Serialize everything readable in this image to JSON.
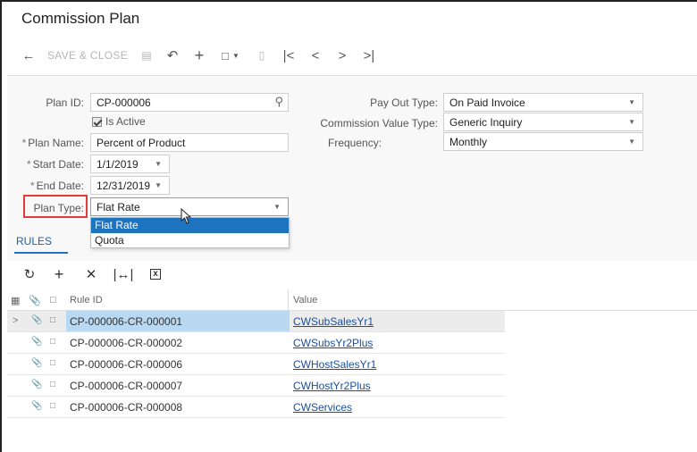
{
  "page": {
    "title": "Commission Plan"
  },
  "toolbar": {
    "save_close": "SAVE & CLOSE",
    "icons": [
      "back-arrow-icon",
      "save-icon",
      "undo-icon",
      "add-icon",
      "copy-icon",
      "delete-icon",
      "first-icon",
      "prev-icon",
      "next-icon",
      "last-icon"
    ]
  },
  "form": {
    "plan_id_label": "Plan ID:",
    "plan_id": "CP-000006",
    "is_active_label": "Is Active",
    "plan_name_label": "Plan Name:",
    "plan_name": "Percent of Product",
    "start_date_label": "Start Date:",
    "start_date": "1/1/2019",
    "end_date_label": "End Date:",
    "end_date": "12/31/2019",
    "plan_type_label": "Plan Type:",
    "plan_type": "Flat Rate",
    "pay_out_type_label": "Pay Out Type:",
    "pay_out_type": "On Paid Invoice",
    "commission_value_type_label": "Commission Value Type:",
    "commission_value_type": "Generic Inquiry",
    "frequency_label": "Frequency:",
    "frequency": "Monthly",
    "required_marker": "*"
  },
  "plan_type_dropdown": {
    "options": [
      "Flat Rate",
      "Quota"
    ],
    "selected_index": 0
  },
  "tabs": {
    "rules": "RULES"
  },
  "grid": {
    "headers": {
      "rule_id": "Rule ID",
      "value": "Value"
    },
    "rows": [
      {
        "rule_id": "CP-000006-CR-000001",
        "value": "CWSubSalesYr1"
      },
      {
        "rule_id": "CP-000006-CR-000002",
        "value": "CWSubsYr2Plus"
      },
      {
        "rule_id": "CP-000006-CR-000006",
        "value": "CWHostSalesYr1"
      },
      {
        "rule_id": "CP-000006-CR-000007",
        "value": "CWHostYr2Plus"
      },
      {
        "rule_id": "CP-000006-CR-000008",
        "value": "CWServices"
      }
    ]
  },
  "colors": {
    "accent": "#1e73be",
    "highlight_border": "#e03b3b",
    "selection": "#b9d8f2"
  }
}
